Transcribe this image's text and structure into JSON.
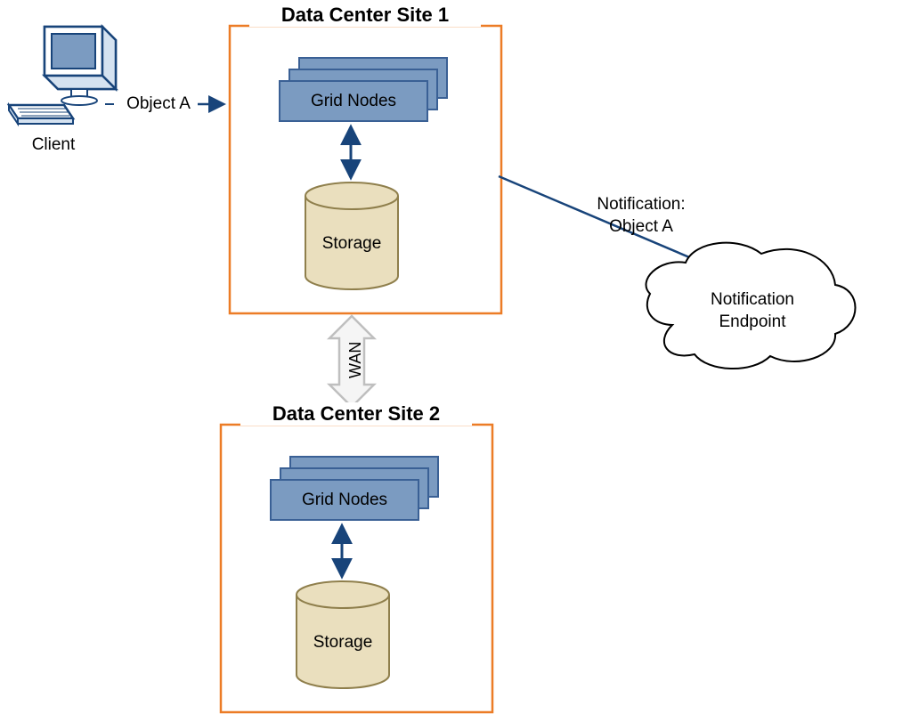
{
  "client": {
    "label": "Client"
  },
  "objectA": {
    "label": "Object A"
  },
  "site1": {
    "title": "Data Center Site 1",
    "gridNodes": "Grid Nodes",
    "storage": "Storage"
  },
  "site2": {
    "title": "Data Center Site 2",
    "gridNodes": "Grid Nodes",
    "storage": "Storage"
  },
  "wan": {
    "label": "WAN"
  },
  "notification": {
    "line1": "Notification:",
    "line2": "Object A"
  },
  "endpoint": {
    "line1": "Notification",
    "line2": "Endpoint"
  },
  "colors": {
    "orange": "#ec7c26",
    "blueFill": "#7b9bc1",
    "blueStroke": "#3a6095",
    "navy": "#18447a",
    "tan": "#eadfbe",
    "tanStroke": "#8f7f4c",
    "grey": "#bfbfbf"
  }
}
